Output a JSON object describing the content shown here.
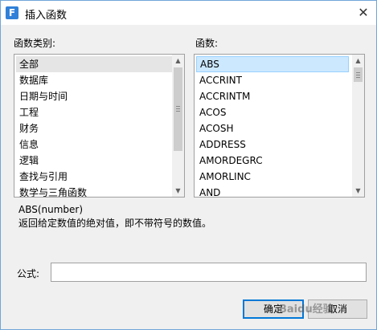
{
  "window": {
    "title": "插入函数",
    "app_icon": "F"
  },
  "category": {
    "label": "函数类别:",
    "items": [
      "全部",
      "数据库",
      "日期与时间",
      "工程",
      "财务",
      "信息",
      "逻辑",
      "查找与引用",
      "数学与三角函数"
    ],
    "selected_index": 0
  },
  "functions": {
    "label": "函数:",
    "items": [
      "ABS",
      "ACCRINT",
      "ACCRINTM",
      "ACOS",
      "ACOSH",
      "ADDRESS",
      "AMORDEGRC",
      "AMORLINC",
      "AND"
    ],
    "selected_index": 0
  },
  "description": {
    "signature": "ABS(number)",
    "text": "返回给定数值的绝对值，即不带符号的数值。"
  },
  "formula": {
    "label": "公式:",
    "value": ""
  },
  "buttons": {
    "ok": "确定",
    "cancel": "取消"
  },
  "watermark": "Baidu经验",
  "colors": {
    "selection_blue": "#cce8ff",
    "accent": "#0078d7"
  }
}
